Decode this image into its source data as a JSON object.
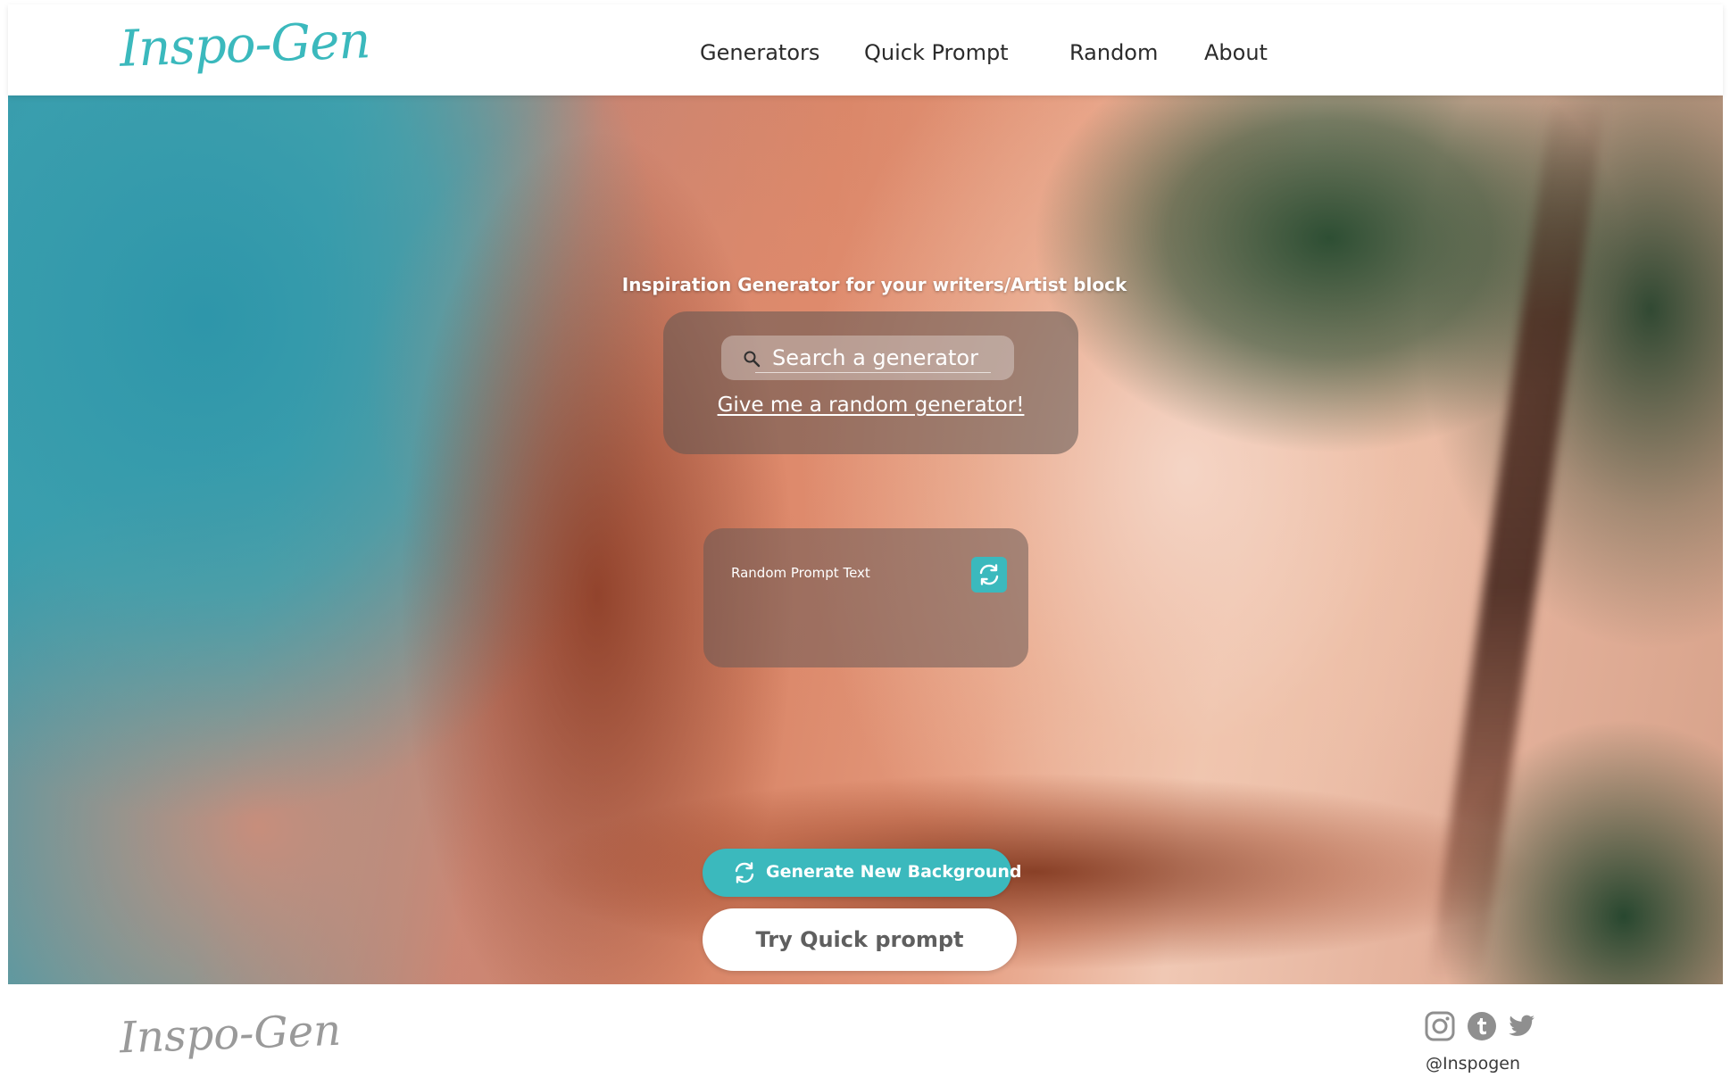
{
  "header": {
    "logo": "Inspo-Gen",
    "nav": [
      "Generators",
      "Quick Prompt",
      "Random",
      "About"
    ]
  },
  "hero": {
    "tagline": "Inspiration Generator for your writers/Artist block",
    "search": {
      "placeholder": "Search a generator",
      "icon": "search-icon"
    },
    "random_link": "Give me a random generator!",
    "prompt_card": {
      "text": "Random Prompt Text",
      "refresh_icon": "refresh-icon"
    },
    "generate_background_label": "Generate New Background",
    "quick_prompt_label": "Try Quick prompt",
    "background_image": "aerial view of turquoise sea, pink and orange sand flats, dark river channel and green trees"
  },
  "footer": {
    "logo": "Inspo-Gen",
    "social": [
      "instagram-icon",
      "tumblr-icon",
      "twitter-icon"
    ],
    "handle": "@Inspogen"
  },
  "colors": {
    "accent": "#3bb9bd",
    "nav_text": "#2b2b2b",
    "footer_logo": "#9a9a9a",
    "panel": "rgba(95,85,82,0.55)"
  }
}
